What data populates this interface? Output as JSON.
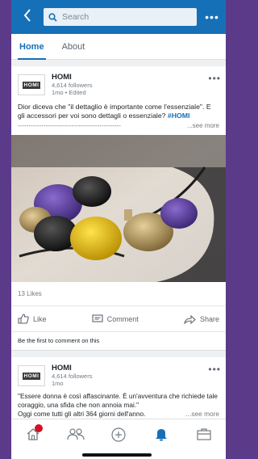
{
  "topbar": {
    "back_icon": "chevron-left-icon",
    "search_placeholder": "Search",
    "more_label": "•••"
  },
  "tabs": [
    {
      "label": "Home",
      "active": true
    },
    {
      "label": "About",
      "active": false
    }
  ],
  "post1": {
    "author": "HOMI",
    "logo_text": "HOMI",
    "followers": "4,614 followers",
    "time": "1mo • Edited",
    "more": "•••",
    "text": "Dior diceva che \"il dettaglio è importante come l'essenziale\". E gli accessori per voi sono dettagli o essenziale? ",
    "hashtag": "#HOMI",
    "dashes": "------------------------------------------------",
    "see_more": "...see more",
    "likes": "13 Likes",
    "actions": {
      "like": "Like",
      "comment": "Comment",
      "share": "Share"
    },
    "first_comment": "Be the first to comment on this"
  },
  "post2": {
    "author": "HOMI",
    "logo_text": "HOMI",
    "followers": "4,614 followers",
    "time": "1mo",
    "more": "•••",
    "text_line1": "\"Essere donna è così affascinante. È un'avventura che richiede tale coraggio, una sfida che non annoia mai.\"",
    "text_line2": "Oggi come tutti gli altri 364 giorni dell'anno.",
    "see_more": "...see more"
  },
  "colors": {
    "brand_blue": "#1670b8",
    "badge_red": "#d11124",
    "background_purple": "#5b3a8a"
  },
  "bottom_nav": {
    "items": [
      "home-icon",
      "my-network-icon",
      "post-icon",
      "notifications-icon",
      "jobs-icon"
    ],
    "active": "notifications-icon"
  }
}
